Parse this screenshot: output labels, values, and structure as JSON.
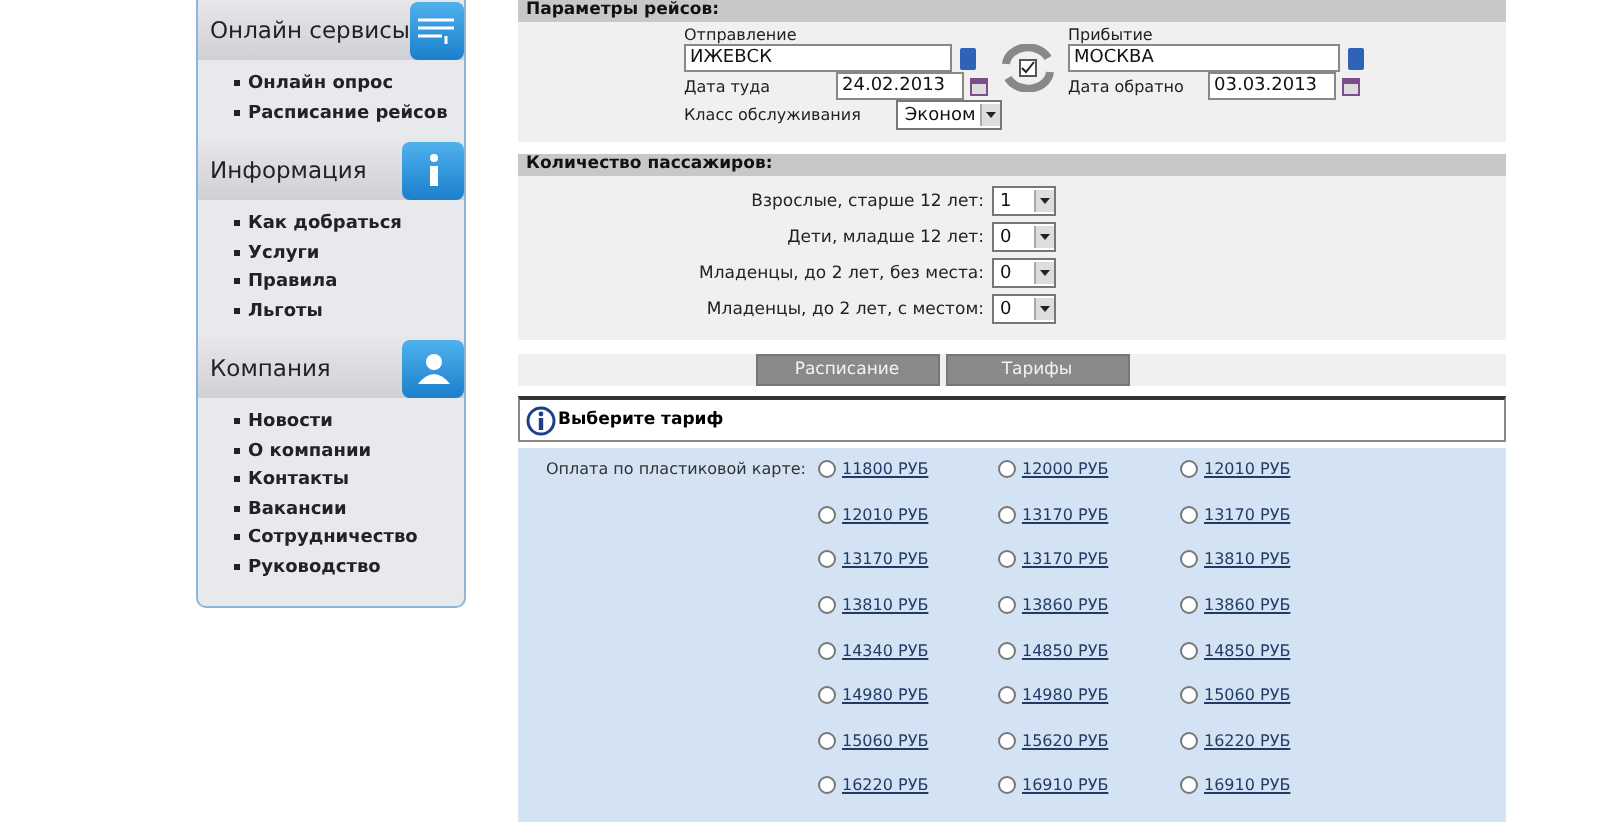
{
  "sidebar": {
    "sections": [
      {
        "title": "Онлайн сервисы",
        "kind": "list",
        "items": [
          "Онлайн опрос",
          "Расписание рейсов"
        ]
      },
      {
        "title": "Информация",
        "kind": "info",
        "items": [
          "Как добраться",
          "Услуги",
          "Правила",
          "Льготы"
        ]
      },
      {
        "title": "Компания",
        "kind": "person",
        "items": [
          "Новости",
          "О компании",
          "Контакты",
          "Вакансии",
          "Сотрудничество",
          "Руководство"
        ]
      }
    ]
  },
  "flight_params": {
    "title": "Параметры рейсов:",
    "departure": {
      "label": "Отправление",
      "value": "ИЖЕВСК"
    },
    "arrival": {
      "label": "Прибытие",
      "value": "МОСКВА"
    },
    "date_out": {
      "label": "Дата туда",
      "value": "24.02.2013"
    },
    "date_back": {
      "label": "Дата обратно",
      "value": "03.03.2013"
    },
    "service_class": {
      "label": "Класс обслуживания",
      "value": "Эконом"
    }
  },
  "passengers": {
    "title": "Количество пассажиров:",
    "rows": [
      {
        "label": "Взрослые, старше 12 лет:",
        "value": "1"
      },
      {
        "label": "Дети, младше 12 лет:",
        "value": "0"
      },
      {
        "label": "Младенцы, до 2 лет, без места:",
        "value": "0"
      },
      {
        "label": "Младенцы, до 2 лет, с местом:",
        "value": "0"
      }
    ]
  },
  "buttons": [
    "Расписание",
    "Тарифы"
  ],
  "notice": "Выберите тариф",
  "fares": {
    "label": "Оплата по пластиковой карте:",
    "rows": [
      [
        {
          "price": "11800 РУБ",
          "selected": false
        },
        {
          "price": "12000 РУБ",
          "selected": false
        },
        {
          "price": "12010 РУБ",
          "selected": false
        }
      ],
      [
        {
          "price": "12010 РУБ",
          "selected": false
        },
        {
          "price": "13170 РУБ",
          "selected": false
        },
        {
          "price": "13170 РУБ",
          "selected": false
        }
      ],
      [
        {
          "price": "13170 РУБ",
          "selected": false
        },
        {
          "price": "13170 РУБ",
          "selected": false
        },
        {
          "price": "13810 РУБ",
          "selected": false
        }
      ],
      [
        {
          "price": "13810 РУБ",
          "selected": false
        },
        {
          "price": "13860 РУБ",
          "selected": false
        },
        {
          "price": "13860 РУБ",
          "selected": false
        }
      ],
      [
        {
          "price": "14340 РУБ",
          "selected": false
        },
        {
          "price": "14850 РУБ",
          "selected": false
        },
        {
          "price": "14850 РУБ",
          "selected": false
        }
      ],
      [
        {
          "price": "14980 РУБ",
          "selected": false
        },
        {
          "price": "14980 РУБ",
          "selected": false
        },
        {
          "price": "15060 РУБ",
          "selected": false
        }
      ],
      [
        {
          "price": "15060 РУБ",
          "selected": false
        },
        {
          "price": "15620 РУБ",
          "selected": false
        },
        {
          "price": "16220 РУБ",
          "selected": false
        }
      ],
      [
        {
          "price": "16220 РУБ",
          "selected": false
        },
        {
          "price": "16910 РУБ",
          "selected": false
        },
        {
          "price": "16910 РУБ",
          "selected": false
        }
      ]
    ]
  }
}
